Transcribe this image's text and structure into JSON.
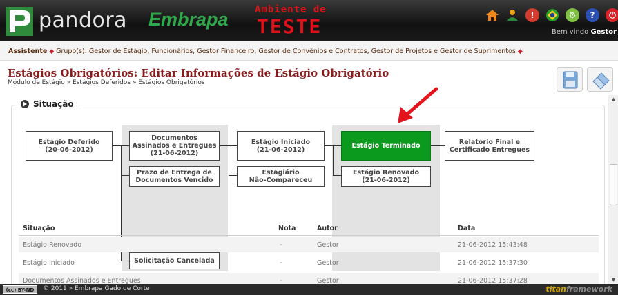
{
  "header": {
    "brand": "pandora",
    "partner": "Embrapa",
    "env_line1": "Ambiente de",
    "env_line2": "TESTE",
    "welcome_prefix": "Bem vindo",
    "welcome_user": "Gestor",
    "icons": [
      "home-icon",
      "user-icon",
      "alert-icon",
      "brazil-flag-icon",
      "settings-icon",
      "help-icon",
      "power-icon"
    ]
  },
  "rolebar": {
    "title": "Assistente",
    "groups_label": "Grupo(s):",
    "groups": "Gestor de Estágio, Funcionários, Gestor Financeiro, Gestor de Convênios e Contratos, Gestor de Projetos e Gestor de Suprimentos"
  },
  "page": {
    "title": "Estágios Obrigatórios: Editar Informações de Estágio Obrigatório",
    "breadcrumb": "Módulo de Estágio » Estágios Deferidos » Estágios Obrigatórios"
  },
  "section": {
    "title": "Situação"
  },
  "flow": {
    "deferido": {
      "line1": "Estágio Deferido",
      "line2": "(20-06-2012)"
    },
    "docs": {
      "line1": "Documentos",
      "line2": "Assinados e Entregues",
      "line3": "(21-06-2012)"
    },
    "prazo": {
      "line1": "Prazo de Entrega de",
      "line2": "Documentos Vencido"
    },
    "cancelada": {
      "line1": "Solicitação Cancelada"
    },
    "iniciado": {
      "line1": "Estágio Iniciado",
      "line2": "(21-06-2012)"
    },
    "nao_compareceu": {
      "line1": "Estagiário",
      "line2": "Não-Compareceu"
    },
    "terminado": {
      "line1": "Estágio Terminado"
    },
    "renovado": {
      "line1": "Estágio Renovado",
      "line2": "(21-06-2012)"
    },
    "relatorio": {
      "line1": "Relatório Final e",
      "line2": "Certificado Entregues"
    }
  },
  "colors": {
    "current_state": "#0b9a1e",
    "title_red": "#8b1c1c",
    "arrow_red": "#e3141c"
  },
  "table": {
    "headers": {
      "situacao": "Situação",
      "nota": "Nota",
      "autor": "Autor",
      "data": "Data"
    },
    "rows": [
      {
        "situacao": "Estágio Renovado",
        "nota": "-",
        "autor": "Gestor",
        "data": "21-06-2012 15:43:48"
      },
      {
        "situacao": "Estágio Iniciado",
        "nota": "-",
        "autor": "Gestor",
        "data": "21-06-2012 15:37:30"
      },
      {
        "situacao": "Documentos Assinados e Entregues",
        "nota": "-",
        "autor": "Gestor",
        "data": "21-06-2012 15:37:28"
      }
    ]
  },
  "footer": {
    "license": "BY-ND",
    "text": "© 2011 » Embrapa Gado de Corte",
    "framework_1": "titan",
    "framework_2": "framework"
  }
}
